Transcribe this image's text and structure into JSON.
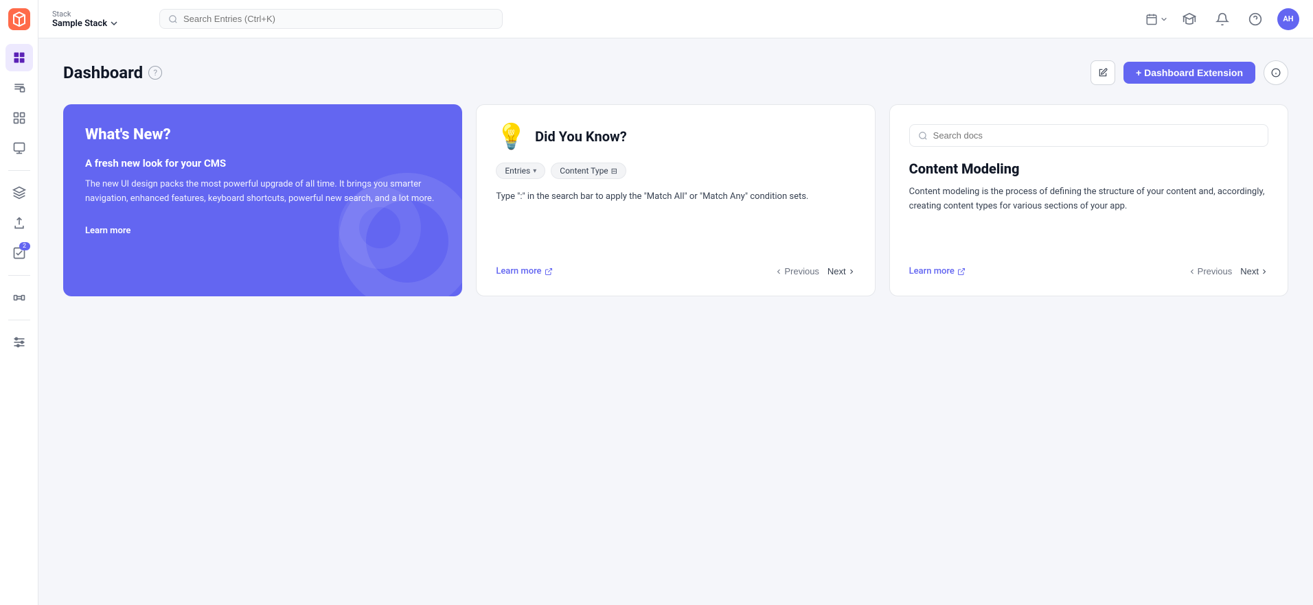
{
  "topbar": {
    "stack_label": "Stack",
    "stack_name": "Sample Stack",
    "search_placeholder": "Search Entries (Ctrl+K)",
    "avatar_initials": "AH"
  },
  "sidebar": {
    "items": [
      {
        "id": "home",
        "label": "Home"
      },
      {
        "id": "entries",
        "label": "Entries"
      },
      {
        "id": "content-model",
        "label": "Content Model"
      },
      {
        "id": "assets",
        "label": "Assets"
      },
      {
        "id": "layers",
        "label": "Layers"
      },
      {
        "id": "workflows",
        "label": "Workflows"
      },
      {
        "id": "releases",
        "label": "Releases"
      },
      {
        "id": "tasks",
        "label": "Tasks",
        "badge": "2"
      },
      {
        "id": "extensions",
        "label": "Extensions"
      },
      {
        "id": "settings",
        "label": "Settings"
      }
    ]
  },
  "page": {
    "title": "Dashboard",
    "edit_label": "Edit",
    "dashboard_ext_label": "+ Dashboard Extension",
    "info_label": "Info"
  },
  "whats_new_card": {
    "title": "What's New?",
    "subtitle": "A fresh new look for your CMS",
    "body": "The new UI design packs the most powerful upgrade of all time. It brings you smarter navigation, enhanced features, keyboard shortcuts, powerful new search, and a lot more.",
    "learn_more": "Learn more"
  },
  "did_you_know_card": {
    "title": "Did You Know?",
    "tag1": "Entries",
    "tag2": "Content Type",
    "body": "Type \":\" in the search bar to apply the \"Match All\" or \"Match Any\" condition sets.",
    "learn_more": "Learn more",
    "prev_label": "Previous",
    "next_label": "Next"
  },
  "docs_card": {
    "search_placeholder": "Search docs",
    "title": "Content Modeling",
    "body": "Content modeling is the process of defining the structure of your content and, accordingly, creating content types for various sections of your app.",
    "learn_more": "Learn more",
    "prev_label": "Previous",
    "next_label": "Next"
  }
}
